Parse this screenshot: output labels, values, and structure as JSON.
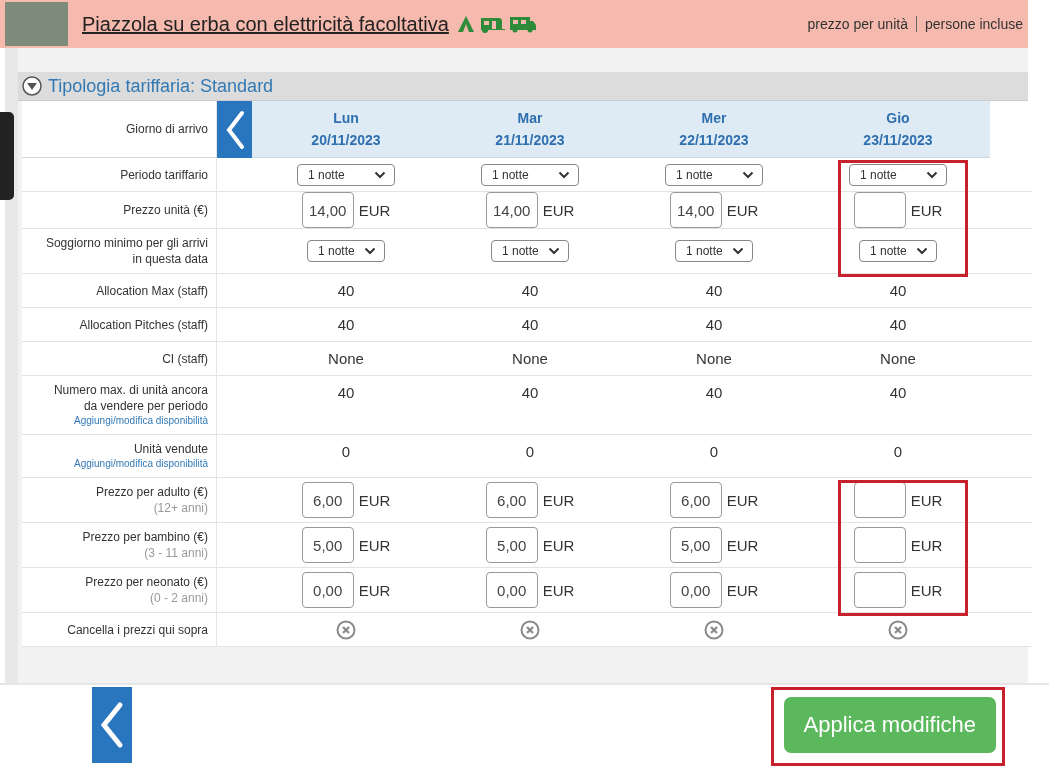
{
  "header": {
    "title": "Piazzola su erba con elettricità facoltativa",
    "links": [
      "prezzo per unità",
      "persone incluse"
    ]
  },
  "section": {
    "title": "Tipologia tariffaria: Standard",
    "expanded": true
  },
  "table": {
    "arrival_label": "Giorno di arrivo",
    "days": [
      {
        "weekday": "Lun",
        "date": "20/11/2023"
      },
      {
        "weekday": "Mar",
        "date": "21/11/2023"
      },
      {
        "weekday": "Mer",
        "date": "22/11/2023"
      },
      {
        "weekday": "Gio",
        "date": "23/11/2023"
      }
    ],
    "rows": [
      {
        "kind": "select",
        "label": "Periodo tariffario",
        "cells": [
          {
            "value": "1 notte",
            "highlighted": false
          },
          {
            "value": "1 notte",
            "highlighted": false
          },
          {
            "value": "1 notte",
            "highlighted": false
          },
          {
            "value": "1 notte",
            "highlighted": true
          }
        ]
      },
      {
        "kind": "price",
        "label": "Prezzo unità (€)",
        "cells": [
          {
            "value": "14,00",
            "unit": "EUR",
            "highlighted": false
          },
          {
            "value": "14,00",
            "unit": "EUR",
            "highlighted": false
          },
          {
            "value": "14,00",
            "unit": "EUR",
            "highlighted": false
          },
          {
            "unit": "EUR",
            "highlighted": true
          }
        ]
      },
      {
        "kind": "compact-select",
        "label": "Soggiorno minimo per gli arrivi in questa data",
        "cells": [
          {
            "value": "1 notte",
            "highlighted": false
          },
          {
            "value": "1 notte",
            "highlighted": false
          },
          {
            "value": "1 notte",
            "highlighted": false
          },
          {
            "value": "1 notte",
            "highlighted": true
          }
        ]
      },
      {
        "kind": "text",
        "label": "Allocation Max (staff)",
        "cells": [
          {
            "value": "40",
            "highlighted": false
          },
          {
            "value": "40",
            "highlighted": false
          },
          {
            "value": "40",
            "highlighted": false
          },
          {
            "value": "40",
            "highlighted": false
          }
        ]
      },
      {
        "kind": "text",
        "label": "Allocation Pitches (staff)",
        "cells": [
          {
            "value": "40",
            "highlighted": false
          },
          {
            "value": "40",
            "highlighted": false
          },
          {
            "value": "40",
            "highlighted": false
          },
          {
            "value": "40",
            "highlighted": false
          }
        ]
      },
      {
        "kind": "text",
        "label": "CI (staff)",
        "cells": [
          {
            "value": "None",
            "highlighted": false
          },
          {
            "value": "None",
            "highlighted": false
          },
          {
            "value": "None",
            "highlighted": false
          },
          {
            "value": "None",
            "highlighted": false
          }
        ]
      },
      {
        "kind": "text",
        "label": "Numero max. di unità ancora da vendere per periodo",
        "link": "Aggiungi/modifica disponibilità",
        "cells": [
          {
            "value": "40",
            "highlighted": false
          },
          {
            "value": "40",
            "highlighted": false
          },
          {
            "value": "40",
            "highlighted": false
          },
          {
            "value": "40",
            "highlighted": false
          }
        ]
      },
      {
        "kind": "text",
        "label": "Unità vendute",
        "link": "Aggiungi/modifica disponibilità",
        "cells": [
          {
            "value": "0",
            "highlighted": false
          },
          {
            "value": "0",
            "highlighted": false
          },
          {
            "value": "0",
            "highlighted": false
          },
          {
            "value": "0",
            "highlighted": false
          }
        ]
      },
      {
        "kind": "price",
        "label": "Prezzo per adulto (€)",
        "note": "(12+ anni)",
        "cells": [
          {
            "value": "6,00",
            "unit": "EUR",
            "highlighted": false
          },
          {
            "value": "6,00",
            "unit": "EUR",
            "highlighted": false
          },
          {
            "value": "6,00",
            "unit": "EUR",
            "highlighted": false
          },
          {
            "unit": "EUR",
            "highlighted": true
          }
        ]
      },
      {
        "kind": "price",
        "label": "Prezzo per bambino (€)",
        "note": "(3 - 11 anni)",
        "cells": [
          {
            "value": "5,00",
            "unit": "EUR",
            "highlighted": false
          },
          {
            "value": "5,00",
            "unit": "EUR",
            "highlighted": false
          },
          {
            "value": "5,00",
            "unit": "EUR",
            "highlighted": false
          },
          {
            "unit": "EUR",
            "highlighted": true
          }
        ]
      },
      {
        "kind": "price",
        "label": "Prezzo per neonato (€)",
        "note": "(0 - 2 anni)",
        "cells": [
          {
            "value": "0,00",
            "unit": "EUR",
            "highlighted": false
          },
          {
            "value": "0,00",
            "unit": "EUR",
            "highlighted": false
          },
          {
            "value": "0,00",
            "unit": "EUR",
            "highlighted": false
          },
          {
            "unit": "EUR",
            "highlighted": true
          }
        ]
      },
      {
        "kind": "clear",
        "label": "Cancella i prezzi qui sopra",
        "cells": [
          {
            "highlighted": false
          },
          {
            "highlighted": false
          },
          {
            "highlighted": false
          },
          {
            "highlighted": false
          }
        ]
      }
    ]
  },
  "apply_button": {
    "label": "Applica modifiche",
    "highlighted": true
  }
}
